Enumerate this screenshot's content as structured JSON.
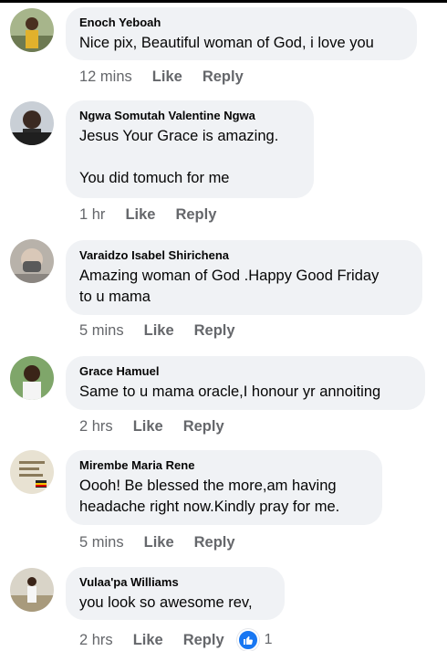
{
  "comments": [
    {
      "author": "Enoch Yeboah",
      "text": "Nice pix, Beautiful woman of God, i love you",
      "time": "12 mins",
      "like": "Like",
      "reply": "Reply"
    },
    {
      "author": "Ngwa Somutah Valentine Ngwa",
      "text": "Jesus Your Grace is amazing.\n\nYou did tomuch for me",
      "time": "1 hr",
      "like": "Like",
      "reply": "Reply"
    },
    {
      "author": "Varaidzo Isabel Shirichena",
      "text": "Amazing woman of God .Happy Good Friday\nto u mama",
      "time": "5 mins",
      "like": "Like",
      "reply": "Reply"
    },
    {
      "author": "Grace Hamuel",
      "text": "Same to u mama oracle,I honour yr annoiting",
      "time": "2 hrs",
      "like": "Like",
      "reply": "Reply"
    },
    {
      "author": "Mirembe Maria Rene",
      "text": "Oooh! Be blessed the more,am having\nheadache right now.Kindly pray for me.",
      "time": "5 mins",
      "like": "Like",
      "reply": "Reply"
    },
    {
      "author": "Vulaa'pa Williams",
      "text": "you look so awesome rev,",
      "time": "2 hrs",
      "like": "Like",
      "reply": "Reply",
      "reaction_icon": "thumbs-up-icon",
      "reaction_count": "1"
    }
  ],
  "colors": {
    "bubble": "#f0f2f5",
    "meta": "#65676b",
    "like_reaction": "#1877f2"
  }
}
